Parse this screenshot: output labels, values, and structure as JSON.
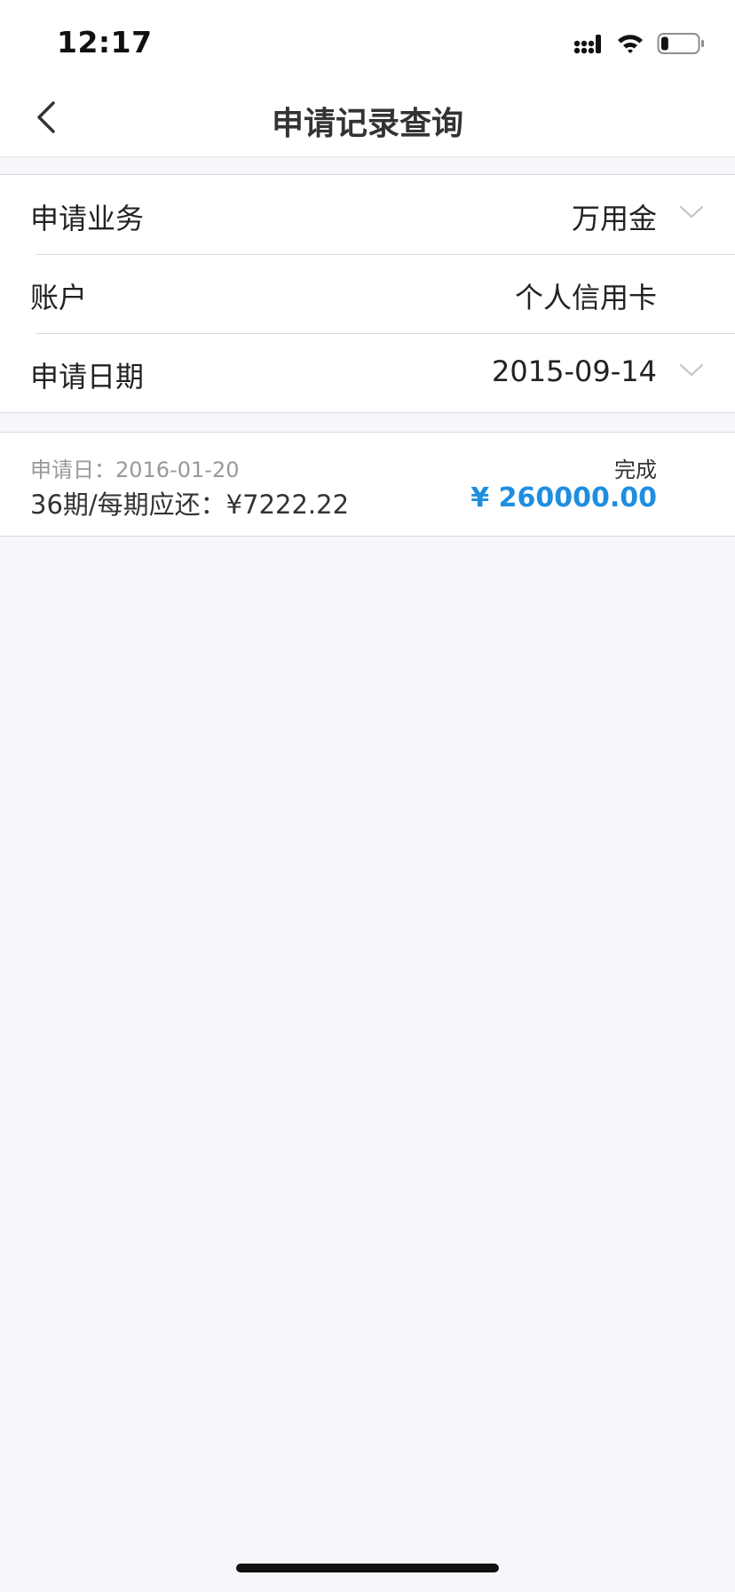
{
  "status_bar": {
    "time": "12:17",
    "icons": [
      "signal-icon",
      "wifi-icon",
      "battery-icon"
    ],
    "battery_level": 0.15
  },
  "nav": {
    "title": "申请记录查询",
    "back_icon": "chevron-left-icon"
  },
  "form": {
    "business": {
      "label": "申请业务",
      "value": "万用金"
    },
    "account": {
      "label": "账户",
      "value": "个人信用卡"
    },
    "date": {
      "label": "申请日期",
      "value": "2015-09-14"
    }
  },
  "records": [
    {
      "date_label": "申请日：",
      "date": "2016-01-20",
      "term": "36期/每期应还：¥7222.22",
      "status": "完成",
      "amount": "¥ 260000.00"
    }
  ],
  "colors": {
    "accent": "#1e8ee0",
    "background": "#f6f7fb",
    "divider": "#d8d9de"
  }
}
